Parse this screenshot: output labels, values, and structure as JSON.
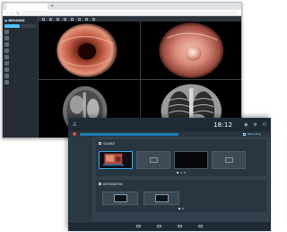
{
  "browser": {
    "tab_title": "",
    "address": "",
    "nav_icons": [
      "back-icon",
      "forward-icon",
      "reload-icon"
    ]
  },
  "viewer": {
    "app_name": "NEXIONS",
    "filters": [
      "",
      ""
    ],
    "studies": [
      {
        "name": "",
        "detail": ""
      },
      {
        "name": "",
        "detail": ""
      },
      {
        "name": "",
        "detail": ""
      },
      {
        "name": "",
        "detail": ""
      },
      {
        "name": "",
        "detail": ""
      },
      {
        "name": "",
        "detail": ""
      },
      {
        "name": "",
        "detail": ""
      },
      {
        "name": "",
        "detail": ""
      },
      {
        "name": "",
        "detail": ""
      }
    ],
    "panes": [
      {
        "label": "",
        "kind": "endoscopy"
      },
      {
        "label": "",
        "kind": "endoscopy-polyp"
      },
      {
        "label": "",
        "kind": "mri-abdomen"
      },
      {
        "label": "",
        "kind": "xray-chest"
      }
    ]
  },
  "encoder": {
    "info_line1": "",
    "info_line2": "",
    "time": "18:12",
    "date": "",
    "recording_label": "Recording",
    "sidebar_label": "",
    "sources_label": "SOURCE",
    "sources": [
      {
        "label": "",
        "state": "active"
      },
      {
        "label": "",
        "state": "idle"
      },
      {
        "label": "",
        "state": "black"
      },
      {
        "label": "",
        "state": "idle"
      }
    ],
    "destinations_label": "DESTINATION",
    "destinations": [
      {
        "label": ""
      },
      {
        "label": ""
      }
    ],
    "colors": {
      "accent": "#3aaee8",
      "record": "#e04848",
      "progress": "#1d7fb6"
    }
  }
}
